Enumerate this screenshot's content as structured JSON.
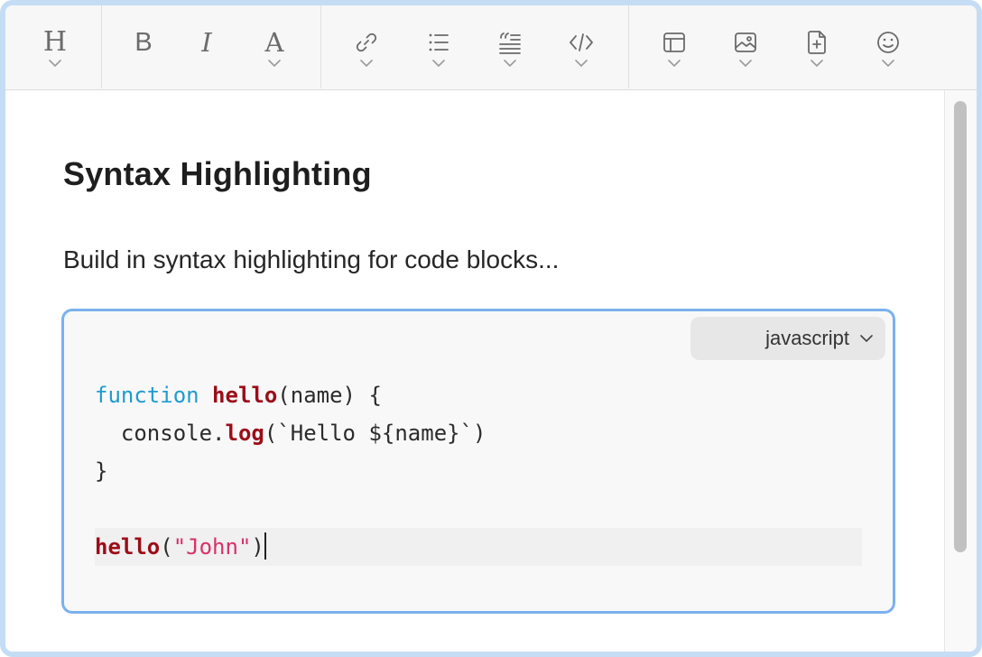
{
  "toolbar": {
    "buttons": [
      {
        "name": "heading",
        "icon": "heading-icon",
        "glyph": "H",
        "dropdown": true
      },
      {
        "name": "bold",
        "icon": "bold-icon",
        "glyph": "B",
        "dropdown": false
      },
      {
        "name": "italic",
        "icon": "italic-icon",
        "glyph": "I",
        "dropdown": false
      },
      {
        "name": "font",
        "icon": "font-style-icon",
        "glyph": "A",
        "dropdown": true
      },
      {
        "name": "link",
        "icon": "link-icon",
        "dropdown": true
      },
      {
        "name": "list",
        "icon": "bulleted-list-icon",
        "dropdown": true
      },
      {
        "name": "quote",
        "icon": "blockquote-icon",
        "dropdown": true
      },
      {
        "name": "code",
        "icon": "code-icon",
        "dropdown": true
      },
      {
        "name": "table",
        "icon": "table-icon",
        "dropdown": true
      },
      {
        "name": "image",
        "icon": "image-icon",
        "dropdown": true
      },
      {
        "name": "file",
        "icon": "add-file-icon",
        "dropdown": true
      },
      {
        "name": "emoji",
        "icon": "emoji-icon",
        "dropdown": true
      }
    ]
  },
  "document": {
    "heading": "Syntax Highlighting",
    "paragraph": "Build in syntax highlighting for code blocks..."
  },
  "codeblock": {
    "language": "javascript",
    "tokens": {
      "l1_kw": "function",
      "l1_fn": "hello",
      "l1_rest": "(name) {",
      "l2_pre": "  console.",
      "l2_fn": "log",
      "l2_rest": "(`Hello ${name}`)",
      "l3": "}",
      "l5_fn": "hello",
      "l5_open": "(",
      "l5_str": "\"John\"",
      "l5_close": ")"
    }
  },
  "colors": {
    "keyword": "#1e9bd0",
    "function": "#9b0d18",
    "string": "#d9306a",
    "focus_border": "#7ab1ee",
    "frame_border": "#c5ddf4"
  }
}
